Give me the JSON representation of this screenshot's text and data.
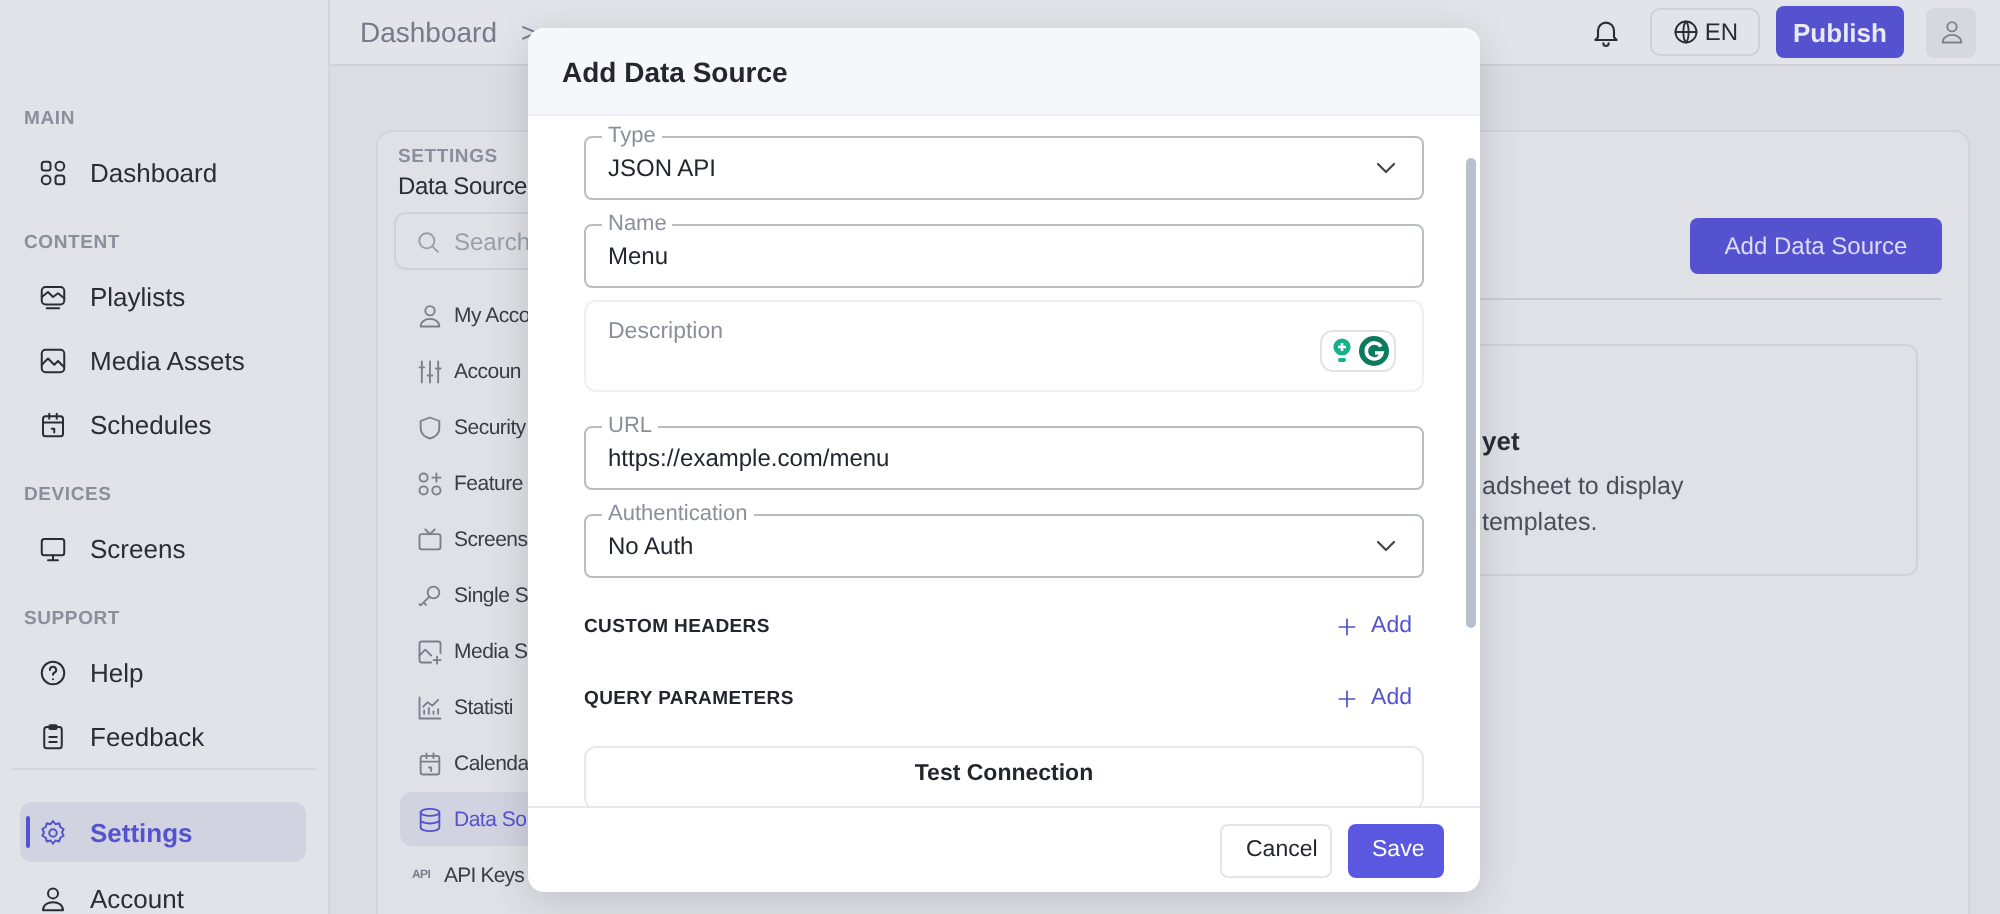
{
  "topbar": {
    "breadcrumb": [
      {
        "label": "Dashboard"
      }
    ],
    "separator": ">",
    "language": "EN",
    "publish": "Publish"
  },
  "sidebar": {
    "sections": [
      {
        "title": "MAIN",
        "items": [
          {
            "label": "Dashboard",
            "kind": "grid",
            "selected": false
          }
        ]
      },
      {
        "title": "CONTENT",
        "items": [
          {
            "label": "Playlists",
            "kind": "playlist",
            "selected": false
          },
          {
            "label": "Media Assets",
            "kind": "image",
            "selected": false
          },
          {
            "label": "Schedules",
            "kind": "calendar",
            "selected": false
          }
        ]
      },
      {
        "title": "DEVICES",
        "items": [
          {
            "label": "Screens",
            "kind": "monitor",
            "selected": false
          }
        ]
      },
      {
        "title": "SUPPORT",
        "items": [
          {
            "label": "Help",
            "kind": "help",
            "selected": false
          },
          {
            "label": "Feedback",
            "kind": "clipboard",
            "selected": false
          }
        ]
      },
      {
        "items": [
          {
            "label": "Settings",
            "kind": "gear",
            "selected": true
          },
          {
            "label": "Account",
            "kind": "user",
            "selected": false
          }
        ]
      }
    ]
  },
  "settings_nav": {
    "heading": "SETTINGS",
    "title": "Data Source",
    "search": {
      "placeholder": "Search"
    },
    "items": [
      {
        "label": "My Acco",
        "kind": "user",
        "selected": false
      },
      {
        "label": "Accoun",
        "kind": "sliders",
        "selected": false
      },
      {
        "label": "Security",
        "kind": "shield",
        "selected": false
      },
      {
        "label": "Feature",
        "kind": "gridplus",
        "selected": false
      },
      {
        "label": "Screens",
        "kind": "tv",
        "selected": false
      },
      {
        "label": "Single S",
        "kind": "key",
        "selected": false
      },
      {
        "label": "Media S",
        "kind": "imageplus",
        "selected": false
      },
      {
        "label": "Statisti",
        "kind": "chart",
        "selected": false
      },
      {
        "label": "Calenda",
        "kind": "calendar",
        "selected": false
      },
      {
        "label": "Data So",
        "kind": "database",
        "selected": true
      },
      {
        "label": "API Keys",
        "kind": "text",
        "icon_text": "API",
        "selected": false
      }
    ]
  },
  "content": {
    "add_button": "Add Data Source",
    "empty_state": {
      "title": "yet",
      "lines": [
        "adsheet to display",
        "templates."
      ]
    }
  },
  "modal": {
    "title": "Add Data Source",
    "fields": [
      {
        "kind": "select",
        "label": "Type",
        "value": "JSON API"
      },
      {
        "kind": "text",
        "label": "Name",
        "value": "Menu"
      },
      {
        "kind": "textarea",
        "placeholder": "Description"
      },
      {
        "kind": "text",
        "label": "URL",
        "value": "https://example.com/menu"
      },
      {
        "kind": "select",
        "label": "Authentication",
        "value": "No Auth"
      }
    ],
    "sections": [
      {
        "title": "CUSTOM HEADERS",
        "action": "Add"
      },
      {
        "title": "QUERY PARAMETERS",
        "action": "Add"
      }
    ],
    "test_button": "Test Connection",
    "buttons": [
      {
        "label": "Cancel",
        "kind": "secondary"
      },
      {
        "label": "Save",
        "kind": "primary"
      }
    ]
  }
}
